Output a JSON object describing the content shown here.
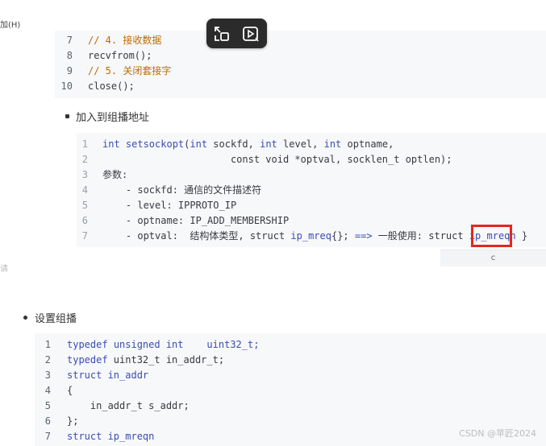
{
  "edge": {
    "top_left": "加(H)",
    "side_mark": "请"
  },
  "block1": {
    "lines": [
      {
        "n": "7",
        "parts": [
          {
            "t": "// 4. 接收数据",
            "c": "cm"
          }
        ]
      },
      {
        "n": "8",
        "parts": [
          {
            "t": "recvfrom();",
            "c": ""
          }
        ]
      },
      {
        "n": "9",
        "parts": [
          {
            "t": "// 5. 关闭套接字",
            "c": "cm"
          }
        ]
      },
      {
        "n": "10",
        "parts": [
          {
            "t": "close();",
            "c": ""
          }
        ]
      }
    ]
  },
  "bullet1": {
    "label": "加入到组播地址"
  },
  "block2": {
    "lines": [
      {
        "n": "1",
        "parts": [
          {
            "t": "int ",
            "c": "kw"
          },
          {
            "t": "setsockopt",
            "c": "fn"
          },
          {
            "t": "(",
            "c": ""
          },
          {
            "t": "int",
            "c": "kw"
          },
          {
            "t": " sockfd, ",
            "c": ""
          },
          {
            "t": "int",
            "c": "kw"
          },
          {
            "t": " level, ",
            "c": ""
          },
          {
            "t": "int",
            "c": "kw"
          },
          {
            "t": " optname,",
            "c": ""
          }
        ]
      },
      {
        "n": "2",
        "parts": [
          {
            "t": "                      const void ",
            "c": "str"
          },
          {
            "t": "*optval, socklen_t optlen);",
            "c": ""
          }
        ]
      },
      {
        "n": "3",
        "parts": [
          {
            "t": "参数:",
            "c": ""
          }
        ]
      },
      {
        "n": "4",
        "parts": [
          {
            "t": "    - sockfd: 通信的文件描述符",
            "c": ""
          }
        ]
      },
      {
        "n": "5",
        "parts": [
          {
            "t": "    - level: IPPROTO_IP",
            "c": ""
          }
        ]
      },
      {
        "n": "6",
        "parts": [
          {
            "t": "    - optname: IP_ADD_MEMBERSHIP",
            "c": ""
          }
        ]
      },
      {
        "n": "7",
        "parts": [
          {
            "t": "    - optval:  结构体类型, struct ",
            "c": ""
          },
          {
            "t": "ip_mreq",
            "c": "kw"
          },
          {
            "t": "{}; ",
            "c": ""
          },
          {
            "t": "==>",
            "c": "kw"
          },
          {
            "t": " 一般使用: struct ",
            "c": ""
          },
          {
            "t": "ip_mreqn",
            "c": "kw"
          },
          {
            "t": " }",
            "c": ""
          }
        ]
      }
    ],
    "copy_label": "c"
  },
  "bullet2": {
    "label": "设置组播"
  },
  "block3": {
    "lines": [
      {
        "n": "1",
        "parts": [
          {
            "t": "typedef",
            "c": "kw"
          },
          {
            "t": " ",
            "c": ""
          },
          {
            "t": "unsigned int",
            "c": "kw"
          },
          {
            "t": "    uint32_t;",
            "c": "kw"
          }
        ]
      },
      {
        "n": "2",
        "parts": [
          {
            "t": "typedef",
            "c": "kw"
          },
          {
            "t": " uint32_t in_addr_t;",
            "c": ""
          }
        ]
      },
      {
        "n": "3",
        "parts": [
          {
            "t": "struct",
            "c": "kw"
          },
          {
            "t": " in_addr",
            "c": "fn"
          }
        ]
      },
      {
        "n": "4",
        "parts": [
          {
            "t": "{",
            "c": ""
          }
        ]
      },
      {
        "n": "5",
        "parts": [
          {
            "t": "    in_addr_t s_addr;",
            "c": ""
          }
        ]
      },
      {
        "n": "6",
        "parts": [
          {
            "t": "};",
            "c": ""
          }
        ]
      },
      {
        "n": "7",
        "parts": [
          {
            "t": "struct",
            "c": "kw"
          },
          {
            "t": " ip_mreqn",
            "c": "fn"
          }
        ]
      }
    ]
  },
  "watermark": "CSDN @苹匠2024"
}
